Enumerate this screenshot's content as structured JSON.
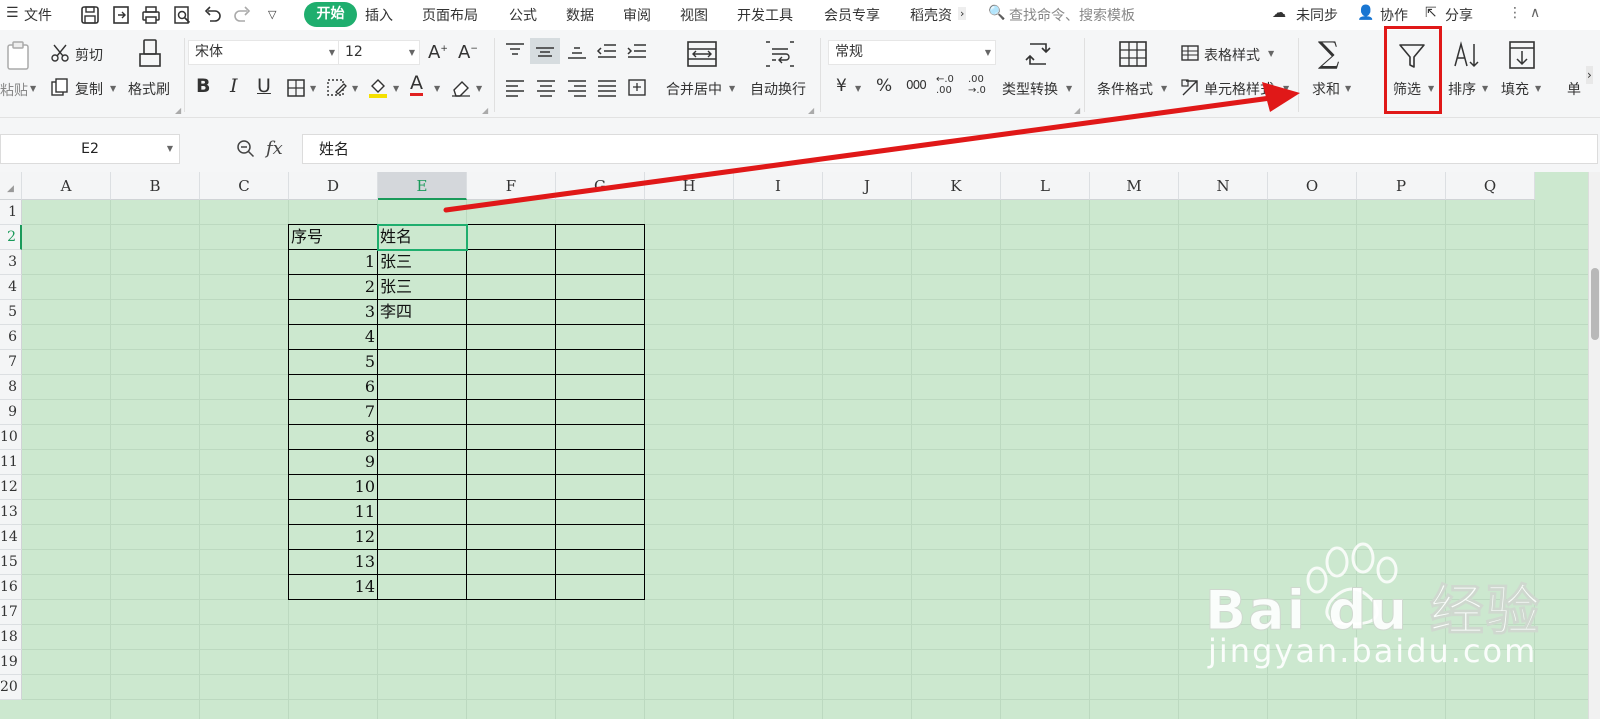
{
  "menubar": {
    "file": "文件",
    "tabs": [
      "开始",
      "插入",
      "页面布局",
      "公式",
      "数据",
      "审阅",
      "视图",
      "开发工具",
      "会员专享",
      "稻壳资"
    ],
    "search_placeholder": "查找命令、搜索模板",
    "sync": "未同步",
    "collab": "协作",
    "share": "分享"
  },
  "ribbon": {
    "paste": "粘贴",
    "cut": "剪切",
    "copy": "复制",
    "format_painter": "格式刷",
    "font_name": "宋体",
    "font_size": "12",
    "bold": "B",
    "italic": "I",
    "underline": "U",
    "font_color_glyph": "A",
    "merge_center": "合并居中",
    "wrap_text": "自动换行",
    "number_format": "常规",
    "currency": "¥",
    "percent": "%",
    "thousands": "000",
    "dec_inc": "←.0 .00",
    "dec_dec": ".00 →.0",
    "type_convert": "类型转换",
    "cond_format": "条件格式",
    "table_style": "表格样式",
    "cell_style": "单元格样式",
    "sum": "求和",
    "filter": "筛选",
    "sort": "排序",
    "fill": "填充",
    "single": "单"
  },
  "formula_bar": {
    "cell_ref": "E2",
    "fx": "fx",
    "content": "姓名"
  },
  "grid": {
    "columns": [
      "A",
      "B",
      "C",
      "D",
      "E",
      "F",
      "G",
      "H",
      "I",
      "J",
      "K",
      "L",
      "M",
      "N",
      "O",
      "P",
      "Q"
    ],
    "rows": [
      "1",
      "2",
      "3",
      "4",
      "5",
      "6",
      "7",
      "8",
      "9",
      "10",
      "11",
      "12",
      "13",
      "14",
      "15",
      "16",
      "17",
      "18",
      "19",
      "20"
    ],
    "selected_col": "E",
    "selected_row": "2",
    "table": {
      "header_seq": "序号",
      "header_name": "姓名",
      "seq": [
        "1",
        "2",
        "3",
        "4",
        "5",
        "6",
        "7",
        "8",
        "9",
        "10",
        "11",
        "12",
        "13",
        "14"
      ],
      "names": [
        "张三",
        "张三",
        "李四",
        "",
        "",
        "",
        "",
        "",
        "",
        "",
        "",
        "",
        "",
        ""
      ]
    }
  },
  "watermark": {
    "brand": "Bai du 经验",
    "url": "jingyan.baidu.com"
  },
  "colors": {
    "accent_green": "#1fae6e",
    "grid_bg": "#cce8cf",
    "annotation_red": "#e01818"
  }
}
